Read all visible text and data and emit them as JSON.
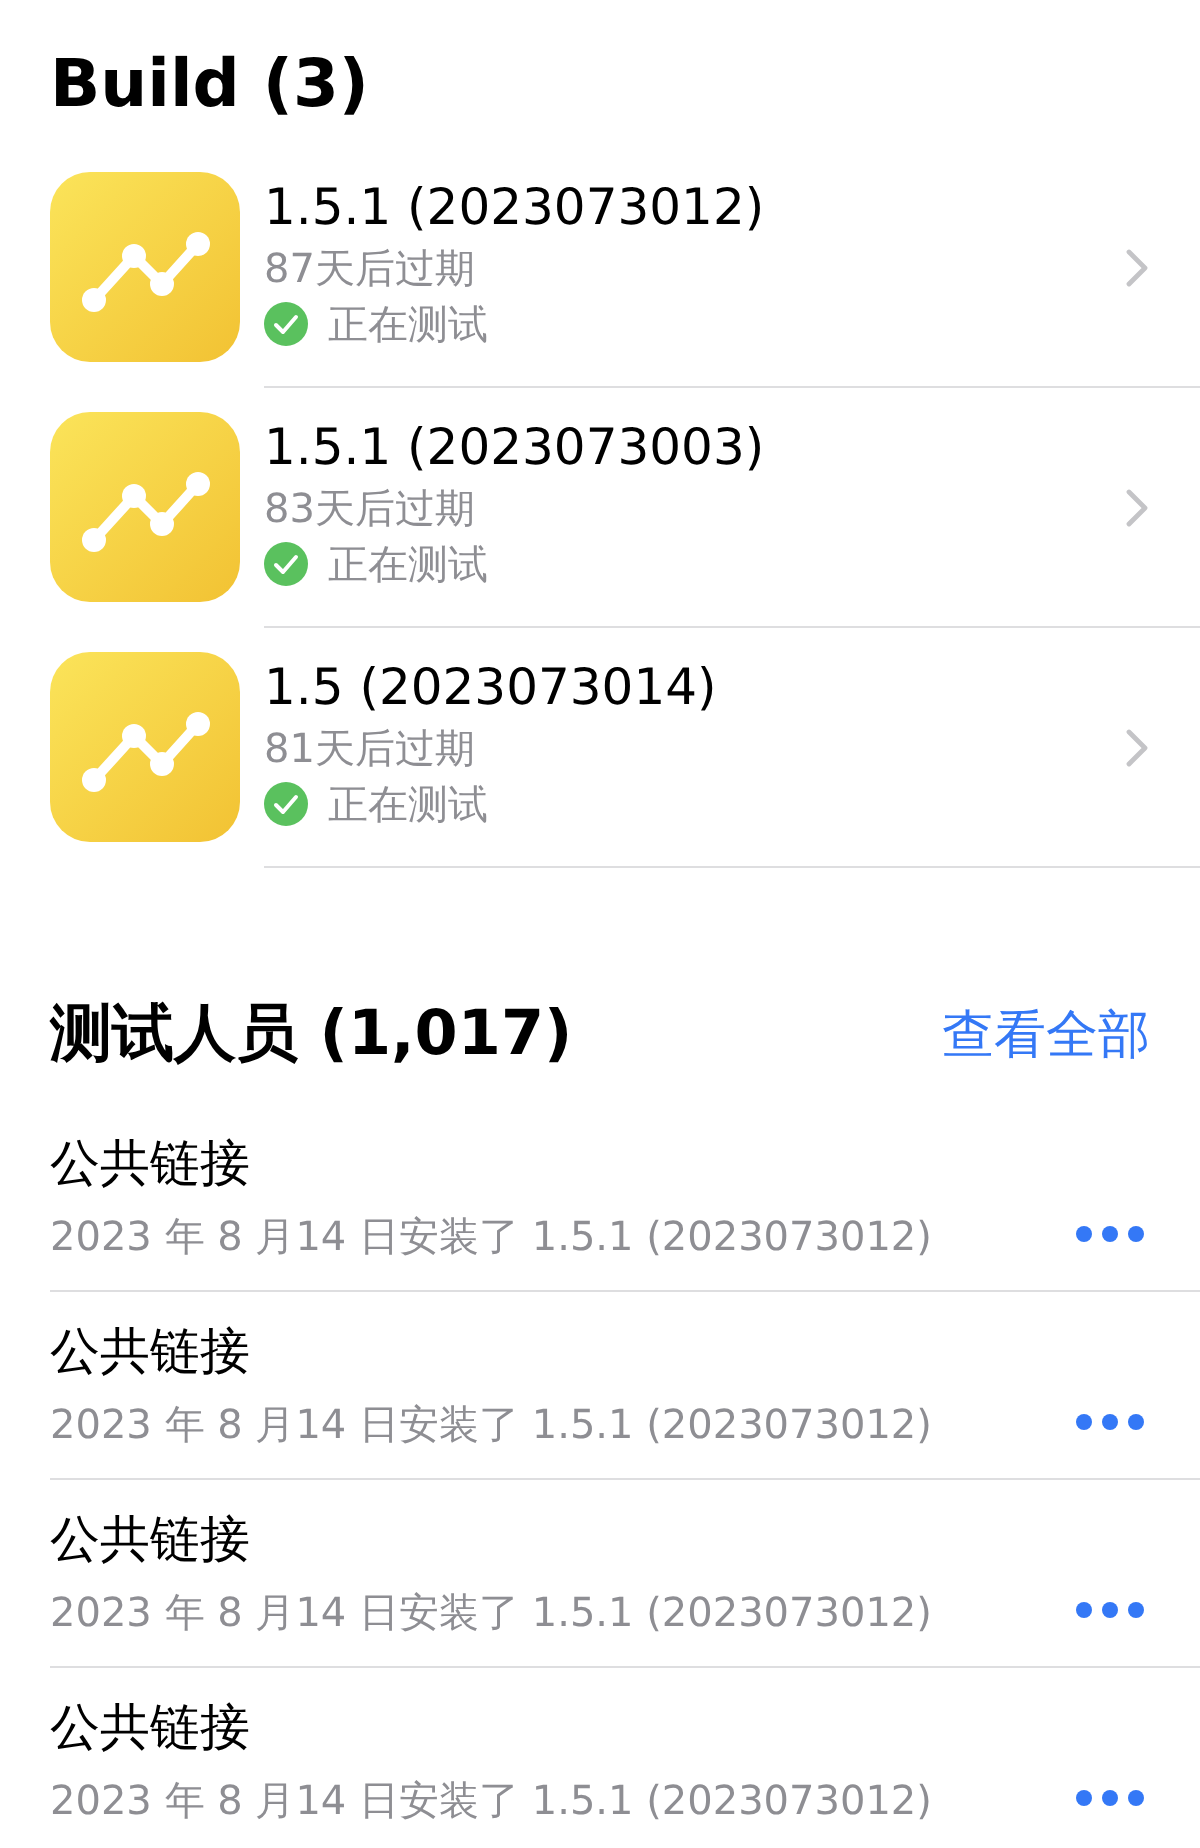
{
  "builds": {
    "title": "Build (3)",
    "items": [
      {
        "version": "1.5.1 (2023073012)",
        "expiry": "87天后过期",
        "status": "正在测试",
        "kind": "testing"
      },
      {
        "version": "1.5.1 (2023073003)",
        "expiry": "83天后过期",
        "status": "正在测试",
        "kind": "testing"
      },
      {
        "version": "1.5 (2023073014)",
        "expiry": "81天后过期",
        "status": "正在测试",
        "kind": "testing"
      }
    ]
  },
  "testers": {
    "title": "测试人员 (1,017)",
    "link": "查看全部",
    "items": [
      {
        "name": "公共链接",
        "detail": "2023 年 8 月14 日安装了 1.5.1 (2023073012)"
      },
      {
        "name": "公共链接",
        "detail": "2023 年 8 月14 日安装了 1.5.1 (2023073012)"
      },
      {
        "name": "公共链接",
        "detail": "2023 年 8 月14 日安装了 1.5.1 (2023073012)"
      },
      {
        "name": "公共链接",
        "detail": "2023 年 8 月14 日安装了 1.5.1 (2023073012)"
      }
    ]
  }
}
